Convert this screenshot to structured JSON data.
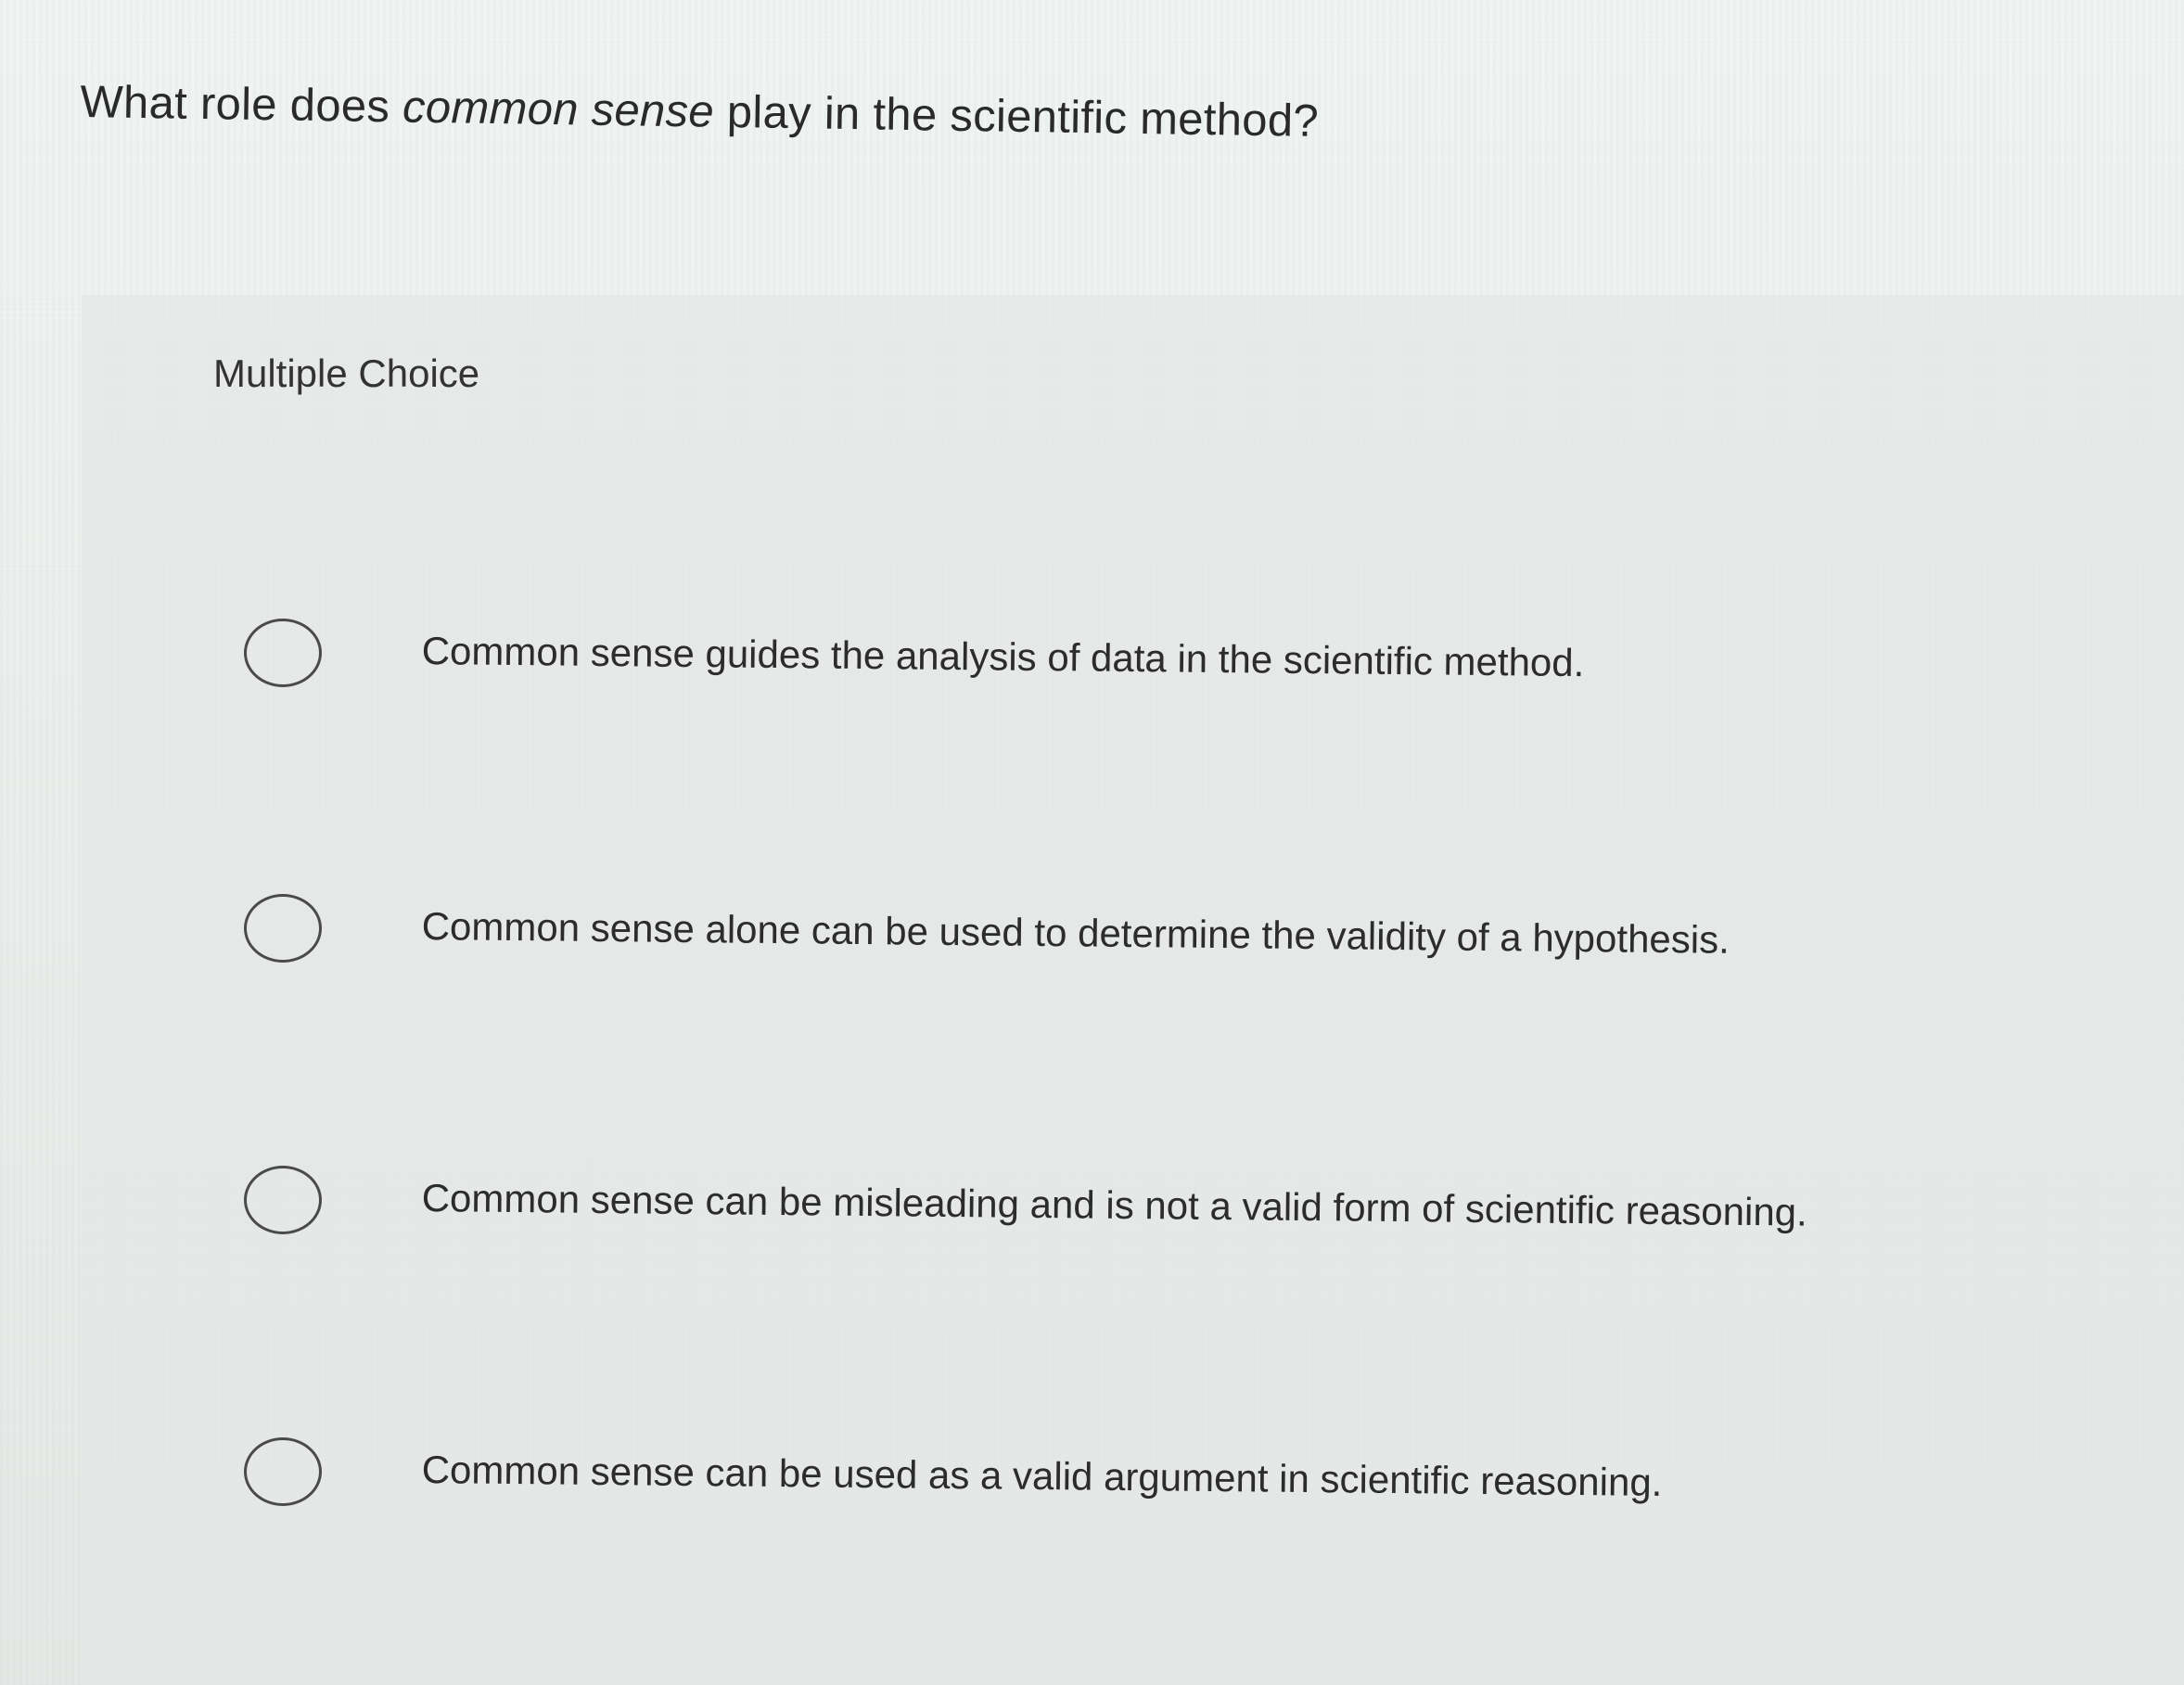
{
  "question": {
    "prefix": "What role does ",
    "emphasis": "common sense",
    "suffix": " play in the scientific method?"
  },
  "question_type": "Multiple Choice",
  "options": [
    {
      "label": "Common sense guides the analysis of data in the scientific method.",
      "selected": false
    },
    {
      "label": "Common sense alone can be used to determine the validity of a hypothesis.",
      "selected": false
    },
    {
      "label": "Common sense can be misleading and is not a valid form of scientific reasoning.",
      "selected": false
    },
    {
      "label": "Common sense can be used as a valid argument in scientific reasoning.",
      "selected": false
    }
  ]
}
